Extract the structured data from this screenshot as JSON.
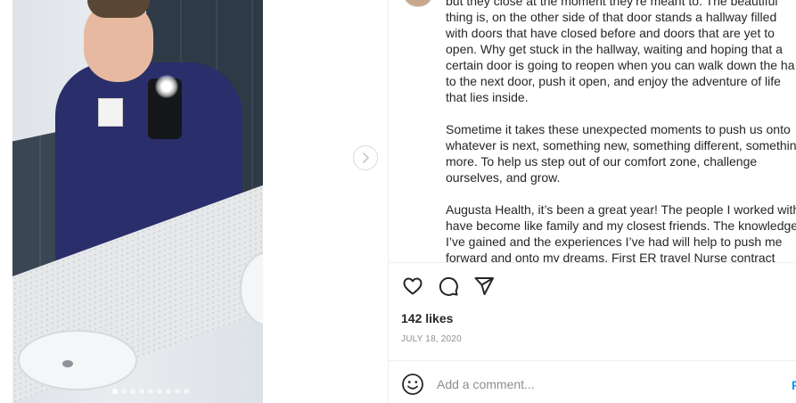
{
  "post": {
    "caption_lines": [
      "but they close at the moment they’re meant to. The beautiful",
      "thing is, on the other side of that door stands a hallway filled",
      "with doors that have closed before and doors that are yet to",
      "open. Why get stuck in the hallway, waiting and hoping that a",
      "certain door is going to reopen when you can walk down the ha",
      "to the next door, push it open, and enjoy the adventure of life",
      "that lies inside.",
      "Sometime it takes these unexpected moments to push us onto",
      "whatever is next, something new, something different, somethin",
      "more. To help us step out of our comfort zone, challenge",
      "ourselves, and grow.",
      "Augusta Health, it’s been a great year! The people I worked with",
      "have become like family and my closest friends. The knowledge",
      "I’ve gained and the experiences I’ve had will help to push me",
      "forward and onto my dreams. First ER travel Nurse contract"
    ],
    "likes": "142 likes",
    "date": "JULY 18, 2020",
    "comment_placeholder": "Add a comment...",
    "post_label": "Post",
    "carousel": {
      "total": 9,
      "active": 0
    }
  },
  "icons": {
    "like": "heart-icon",
    "comment": "comment-icon",
    "share": "paper-plane-icon",
    "emoji": "emoji-icon",
    "next": "chevron-right-icon"
  },
  "colors": {
    "text": "#262626",
    "muted": "#8e8e8e",
    "border": "#efefef",
    "accent": "#0095f6"
  }
}
